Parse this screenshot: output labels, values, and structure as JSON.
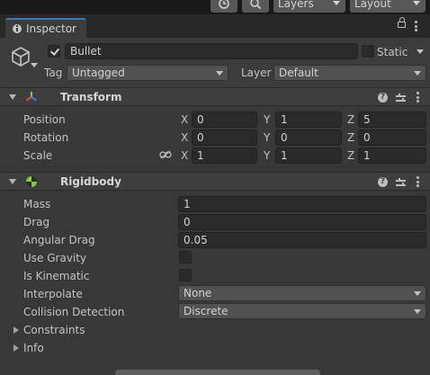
{
  "toolbar": {
    "history_icon": "history-icon",
    "search_icon": "search-icon",
    "layers_label": "Layers",
    "layout_label": "Layout"
  },
  "tab": {
    "label": "Inspector",
    "icon": "info-icon"
  },
  "gameobject": {
    "icon": "cube-icon",
    "active": true,
    "name": "Bullet",
    "static_label": "Static",
    "static_checked": false,
    "tag_label": "Tag",
    "tag_value": "Untagged",
    "layer_label": "Layer",
    "layer_value": "Default"
  },
  "transform": {
    "title": "Transform",
    "icon": "transform-axes-icon",
    "rows": [
      {
        "label": "Position",
        "x": "0",
        "y": "1",
        "z": "5"
      },
      {
        "label": "Rotation",
        "x": "0",
        "y": "0",
        "z": "0"
      },
      {
        "label": "Scale",
        "x": "1",
        "y": "1",
        "z": "1"
      }
    ],
    "axis_labels": [
      "X",
      "Y",
      "Z"
    ],
    "scale_link_icon": "unlinked-chain-icon"
  },
  "rigidbody": {
    "title": "Rigidbody",
    "icon": "rigidbody-ball-icon",
    "mass_label": "Mass",
    "mass": "1",
    "drag_label": "Drag",
    "drag": "0",
    "angular_drag_label": "Angular Drag",
    "angular_drag": "0.05",
    "use_gravity_label": "Use Gravity",
    "use_gravity": false,
    "is_kinematic_label": "Is Kinematic",
    "is_kinematic": false,
    "interpolate_label": "Interpolate",
    "interpolate": "None",
    "collision_label": "Collision Detection",
    "collision": "Discrete",
    "constraints_label": "Constraints",
    "info_label": "Info"
  },
  "colors": {
    "panel_bg": "#383838",
    "header_bg": "#3e3e3e",
    "field_bg": "#2a2a2a",
    "tab_accent": "#3a79bb",
    "rigidbody_icon": "#7fd13b"
  }
}
